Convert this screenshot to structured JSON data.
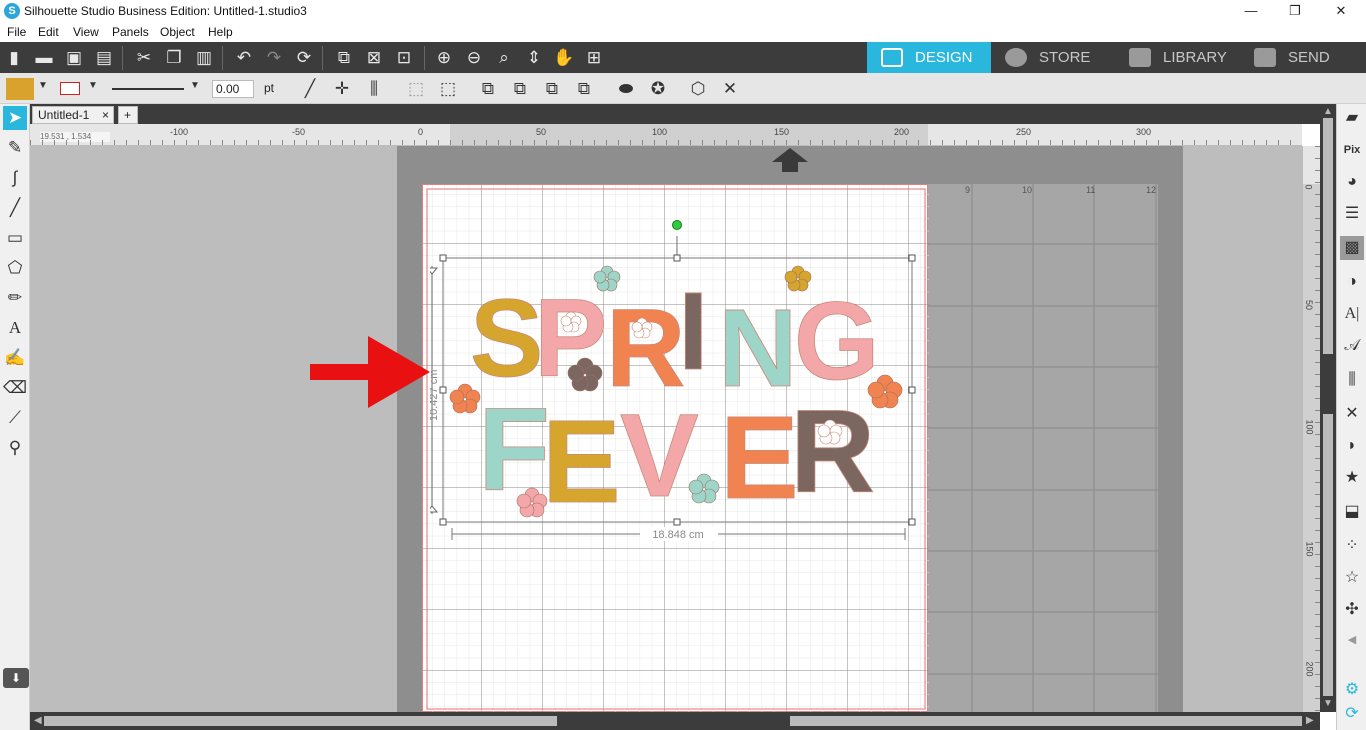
{
  "window": {
    "title": "Silhouette Studio Business Edition: Untitled-1.studio3",
    "app_icon": "S",
    "controls": {
      "minimize": "—",
      "maximize": "❐",
      "close": "✕"
    }
  },
  "menu": [
    "File",
    "Edit",
    "View",
    "Panels",
    "Object",
    "Help"
  ],
  "nav_tabs": [
    {
      "label": "DESIGN",
      "icon": "grid-icon",
      "active": true
    },
    {
      "label": "STORE",
      "icon": "store-icon",
      "active": false
    },
    {
      "label": "LIBRARY",
      "icon": "library-icon",
      "active": false
    },
    {
      "label": "SEND",
      "icon": "send-icon",
      "active": false
    }
  ],
  "properties": {
    "fill_color": "#d8a22c",
    "line_color": "#cc2222",
    "line_width": "0.00",
    "line_unit": "pt"
  },
  "document": {
    "tab_label": "Untitled-1",
    "close_glyph": "×",
    "add_glyph": "+",
    "cursor_readout": "19.531 , 1.534"
  },
  "ruler": {
    "horizontal": [
      "-100",
      "-50",
      "0",
      "50",
      "100",
      "150",
      "200",
      "250",
      "300"
    ],
    "vertical": [
      "0",
      "50",
      "100",
      "150",
      "200"
    ],
    "mat_columns": [
      "9",
      "10",
      "11",
      "12"
    ]
  },
  "design": {
    "line1": [
      "S",
      "P",
      "R",
      "I",
      "N",
      "G"
    ],
    "line2": [
      "F",
      "E",
      "V",
      "E",
      "R"
    ],
    "width_label": "18.848 cm",
    "height_label": "10.427 cm"
  },
  "colors": {
    "mustard": "#d6a52e",
    "pink": "#f4a7a8",
    "orange": "#f0834f",
    "brown": "#7b6660",
    "mint": "#9ed5c9",
    "accent_blue": "#29b7dd",
    "arrow_red": "#e81010"
  }
}
